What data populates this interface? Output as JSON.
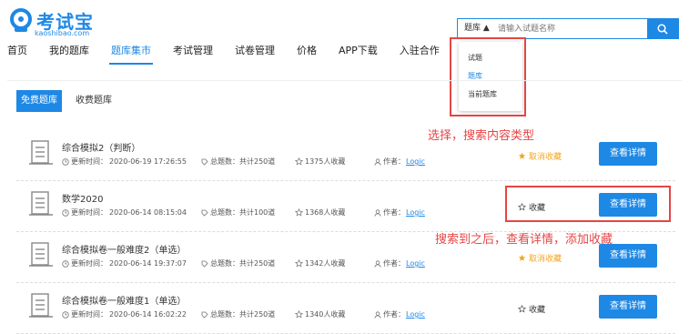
{
  "logo": {
    "title": "考试宝",
    "subtitle": "kaoshibao.com",
    "brand_color": "#1e88e5"
  },
  "nav": [
    {
      "label": "首页"
    },
    {
      "label": "我的题库"
    },
    {
      "label": "题库集市"
    },
    {
      "label": "考试管理"
    },
    {
      "label": "试卷管理"
    },
    {
      "label": "价格"
    },
    {
      "label": "APP下载"
    },
    {
      "label": "入驻合作"
    }
  ],
  "nav_active": "题库集市",
  "search": {
    "type_label": "题库 ▲",
    "placeholder": "请输入试题名称"
  },
  "dropdown": {
    "items": [
      "试题",
      "题库",
      "当前题库"
    ],
    "selected": "题库"
  },
  "annotations": {
    "select_type": "选择，搜索内容类型",
    "after_search": "搜索到之后，查看详情，添加收藏"
  },
  "tabs": [
    {
      "label": "免费题库"
    },
    {
      "label": "收费题库"
    }
  ],
  "tab_active": "免费题库",
  "labels": {
    "updated": "更新时间：",
    "total_questions": "总题数：",
    "favorites_suffix": " 人收藏",
    "author": "作者：",
    "detail_button": "查看详情"
  },
  "banks": [
    {
      "title": "综合模拟2（判断）",
      "updated": "2020-06-19 17:26:55",
      "total": "共计250道",
      "favorites": "1375",
      "author": "Logic",
      "fav_state": "取消收藏",
      "favorited": true
    },
    {
      "title": "数学2020",
      "updated": "2020-06-14 08:15:04",
      "total": "共计100道",
      "favorites": "1368",
      "author": "Logic",
      "fav_state": "收藏",
      "favorited": false
    },
    {
      "title": "综合模拟卷一般难度2（单选）",
      "updated": "2020-06-14 19:37:07",
      "total": "共计250道",
      "favorites": "1342",
      "author": "Logic",
      "fav_state": "取消收藏",
      "favorited": true
    },
    {
      "title": "综合模拟卷一般难度1（单选）",
      "updated": "2020-06-14 16:02:22",
      "total": "共计250道",
      "favorites": "1340",
      "author": "Logic",
      "fav_state": "收藏",
      "favorited": false
    }
  ],
  "colors": {
    "accent": "#1e88e5",
    "annotation": "#e64545",
    "favorited": "#f5a623"
  }
}
